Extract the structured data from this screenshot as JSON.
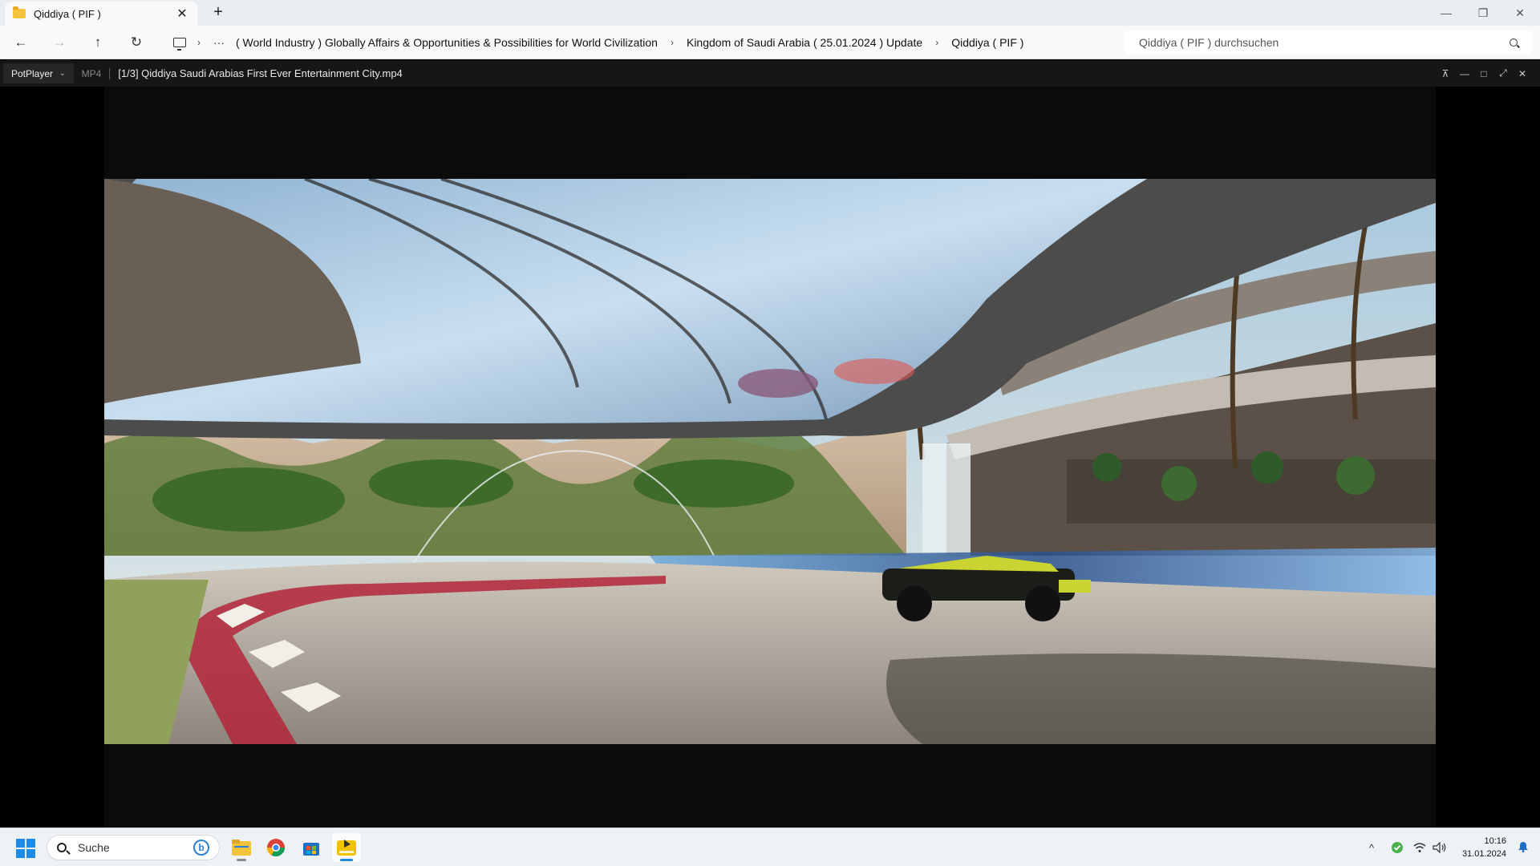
{
  "explorer": {
    "tab_title": "Qiddiya ( PIF )",
    "tab_close": "✕",
    "new_tab": "+",
    "window_controls": {
      "minimize": "—",
      "maximize": "❐",
      "close": "✕"
    },
    "nav": {
      "back": "←",
      "forward": "→",
      "up": "↑",
      "refresh": "↻",
      "more": "···"
    },
    "breadcrumb": [
      "( World Industry ) Globally Affairs & Opportunities & Possibilities for World Civilization",
      "Kingdom of Saudi Arabia ( 25.01.2024 ) Update",
      "Qiddiya ( PIF )"
    ],
    "breadcrumb_sep": "›",
    "search_placeholder": "Qiddiya ( PIF ) durchsuchen"
  },
  "player": {
    "menu_label": "PotPlayer",
    "menu_chevron": "⌄",
    "format": "MP4",
    "file_title": "[1/3] Qiddiya  Saudi Arabias First Ever Entertainment City.mp4",
    "controls": {
      "pin": "⊼",
      "minimize": "—",
      "maximize": "□",
      "fullscreen": "⤢",
      "close": "✕"
    }
  },
  "taskbar": {
    "search_label": "Suche",
    "bing_label": "b",
    "tray_chevron": "^",
    "time": "10:16",
    "date": "31.01.2024",
    "icons": [
      "windows-start-icon",
      "file-explorer-icon",
      "chrome-icon",
      "microsoft-store-icon",
      "potplayer-icon",
      "security-shield-icon",
      "wifi-icon",
      "volume-icon",
      "notification-bell-icon"
    ]
  },
  "colors": {
    "accent": "#1d8ae6",
    "player_bg": "#161616",
    "taskbar_bg": "#eef2f6"
  }
}
